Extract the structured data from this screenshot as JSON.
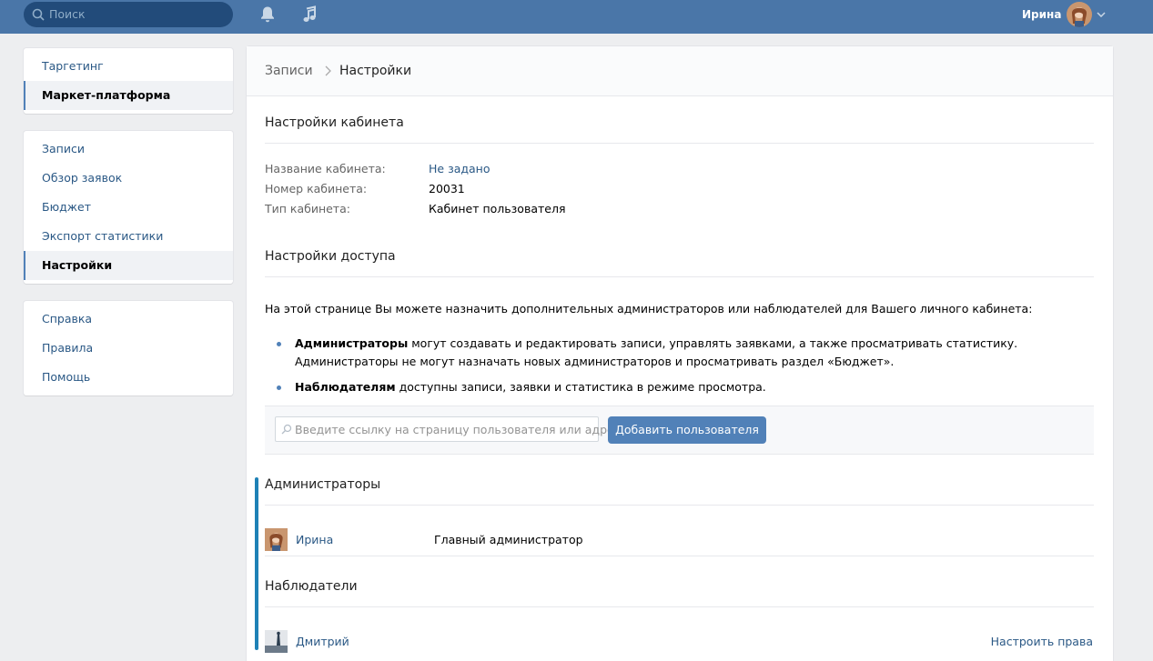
{
  "topbar": {
    "search_placeholder": "Поиск",
    "user_name": "Ирина",
    "icons": [
      "search-icon",
      "bell-icon",
      "music-icon",
      "chevron-down-icon"
    ]
  },
  "menus": [
    {
      "items": [
        {
          "label": "Таргетинг",
          "active": false
        },
        {
          "label": "Маркет-платформа",
          "active": true
        }
      ]
    },
    {
      "items": [
        {
          "label": "Записи",
          "active": false
        },
        {
          "label": "Обзор заявок",
          "active": false
        },
        {
          "label": "Бюджет",
          "active": false
        },
        {
          "label": "Экспорт статистики",
          "active": false
        },
        {
          "label": "Настройки",
          "active": true
        }
      ]
    },
    {
      "items": [
        {
          "label": "Справка",
          "active": false
        },
        {
          "label": "Правила",
          "active": false
        },
        {
          "label": "Помощь",
          "active": false
        }
      ]
    }
  ],
  "breadcrumb": {
    "parent": "Записи",
    "current": "Настройки"
  },
  "cabinet": {
    "title": "Настройки кабинета",
    "fields": [
      {
        "label": "Название кабинета:",
        "value": "Не задано",
        "is_link": true
      },
      {
        "label": "Номер кабинета:",
        "value": "20031",
        "is_link": false
      },
      {
        "label": "Тип кабинета:",
        "value": "Кабинет пользователя",
        "is_link": false
      }
    ]
  },
  "access": {
    "title": "Настройки доступа",
    "intro": "На этой странице Вы можете назначить дополнительных администраторов или наблюдателей для Вашего личного кабинета:",
    "bullets": [
      {
        "bold": "Администраторы",
        "text": " могут создавать и редактировать записи, управлять заявками, а также просматривать статистику.",
        "text2": "Администраторы не могут назначать новых администраторов и просматривать раздел «Бюджет»."
      },
      {
        "bold": "Наблюдателям",
        "text": " доступны записи, заявки и статистика в режиме просмотра."
      }
    ],
    "input_placeholder": "Введите ссылку на страницу пользователя или адре...",
    "add_button": "Добавить пользователя"
  },
  "admins": {
    "title": "Администраторы",
    "rows": [
      {
        "name": "Ирина",
        "role": "Главный администратор"
      }
    ]
  },
  "observers": {
    "title": "Наблюдатели",
    "rows": [
      {
        "name": "Дмитрий",
        "action": "Настроить права"
      }
    ]
  },
  "colors": {
    "header": "#4a76a8",
    "accent": "#5181b8",
    "link": "#2a5885",
    "section_marker": "#1e81b6"
  }
}
